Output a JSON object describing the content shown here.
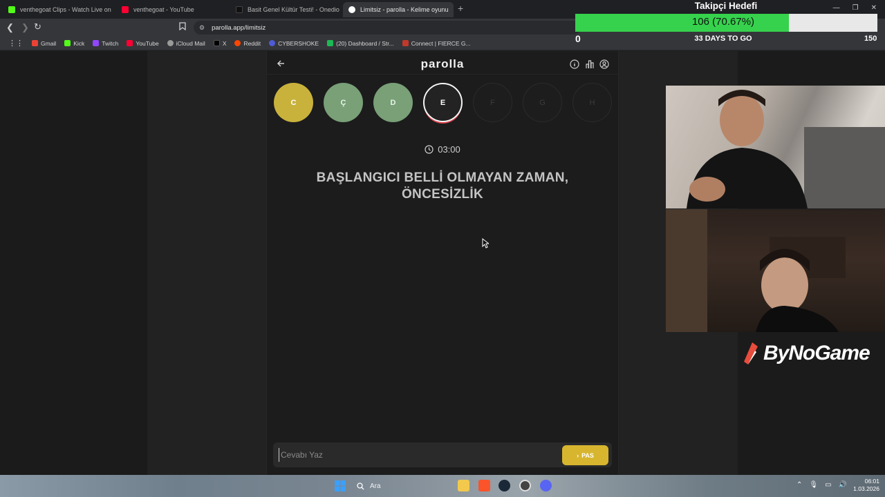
{
  "browser": {
    "tabs": [
      {
        "label": "venthegoat Clips - Watch Live on Kick",
        "color": "#53fc18"
      },
      {
        "label": "venthegoat - YouTube",
        "color": "#ff0033"
      },
      {
        "label": "Basit Genel Kültür Testi! - Onedio",
        "color": "#111111"
      },
      {
        "label": "Limitsiz - parolla - Kelime oyunu",
        "color": "#ffffff"
      }
    ],
    "url": "parolla.app/limitsiz",
    "bookmarks": [
      {
        "label": "Gmail",
        "color": "#ea4335"
      },
      {
        "label": "Kick",
        "color": "#53fc18"
      },
      {
        "label": "Twitch",
        "color": "#9146ff"
      },
      {
        "label": "YouTube",
        "color": "#ff0033"
      },
      {
        "label": "iCloud Mail",
        "color": "#9a9a9a"
      },
      {
        "label": "X",
        "color": "#000000"
      },
      {
        "label": "Reddit",
        "color": "#ff4500"
      },
      {
        "label": "CYBERSHOKE",
        "color": "#4f5bd5"
      },
      {
        "label": "(20) Dashboard / Str...",
        "color": "#1db954"
      },
      {
        "label": "Connect | FIERCE G...",
        "color": "#c0392b"
      }
    ]
  },
  "app": {
    "logo": "parolla",
    "letters": [
      {
        "char": "C",
        "state": "correct-y"
      },
      {
        "char": "Ç",
        "state": "correct-g"
      },
      {
        "char": "D",
        "state": "correct-g"
      },
      {
        "char": "E",
        "state": "current"
      },
      {
        "char": "F",
        "state": "pending"
      },
      {
        "char": "G",
        "state": "pending"
      },
      {
        "char": "H",
        "state": "pending"
      }
    ],
    "timer": "03:00",
    "question_line1": "BAŞLANGICI BELLİ OLMAYAN ZAMAN,",
    "question_line2": "ÖNCESİZLİK",
    "answer_placeholder": "Cevabı Yaz",
    "pass_label": "PAS"
  },
  "goal": {
    "title": "Takipçi Hedefi",
    "value_text": "106 (70.67%)",
    "progress": 0.7067,
    "min": "0",
    "max": "150",
    "days_left": "33 DAYS TO GO"
  },
  "sponsor": "ByNoGame",
  "taskbar": {
    "search": "Ara",
    "time": "06:01",
    "date": "1.03.2026"
  }
}
